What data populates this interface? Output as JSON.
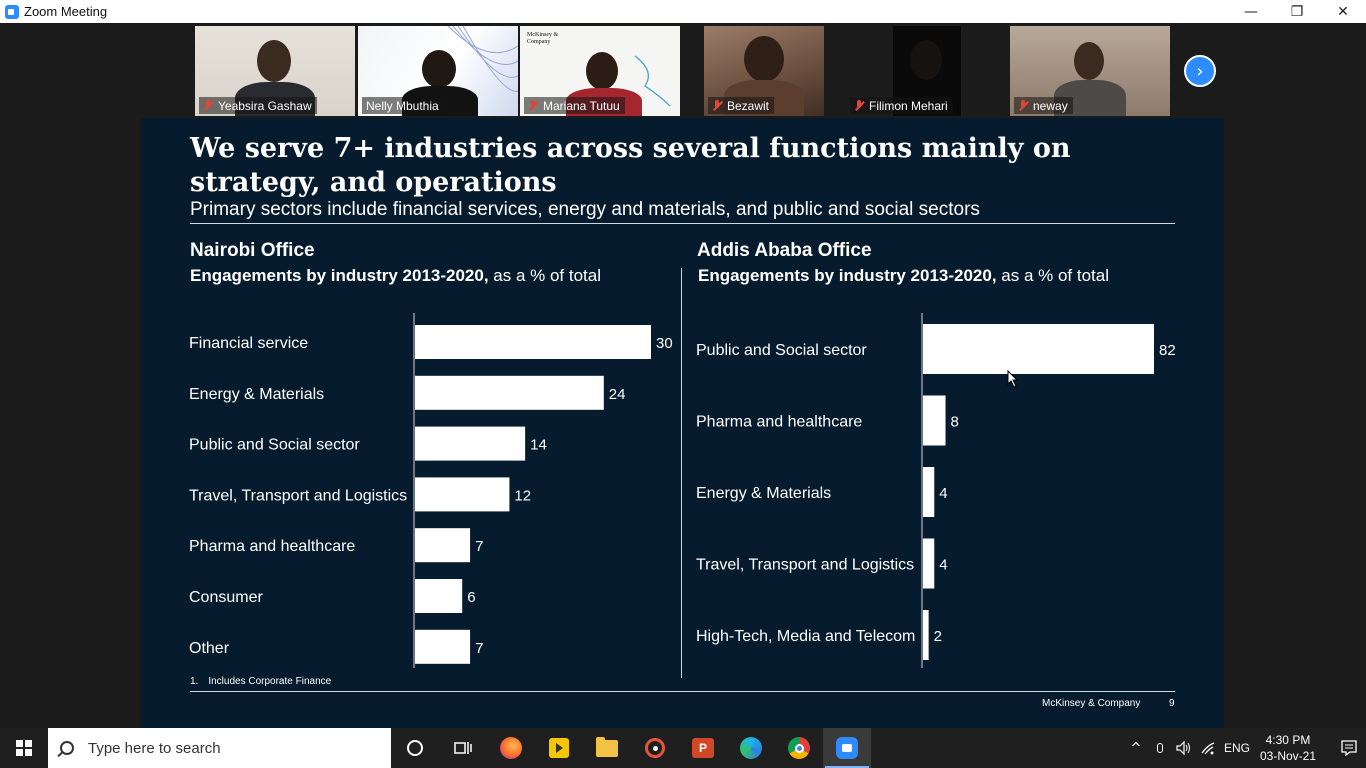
{
  "window": {
    "title": "Zoom Meeting",
    "minimize": "—",
    "restore": "❐",
    "close": "✕"
  },
  "participants": [
    {
      "name": "Yeabsira Gashaw",
      "muted": true,
      "active": false
    },
    {
      "name": "Nelly Mbuthia",
      "muted": false,
      "active": true
    },
    {
      "name": "Mariana Tutuu",
      "muted": true,
      "active": false,
      "logo": "McKinsey & Company"
    },
    {
      "name": "Bezawit",
      "muted": true,
      "active": false
    },
    {
      "name": "Filimon Mehari",
      "muted": true,
      "active": false
    },
    {
      "name": "neway",
      "muted": true,
      "active": false
    }
  ],
  "next_page_glyph": "›",
  "slide": {
    "title": "We serve 7+ industries across several functions mainly on strategy, and operations",
    "subtitle": "Primary sectors include financial services, energy and materials, and public and social sectors",
    "left_office": "Nairobi Office",
    "right_office": "Addis Ababa Office",
    "eng_bold": "Engagements by industry 2013-2020,",
    "eng_rest": " as a % of total",
    "footnote_num": "1.",
    "footnote_text": "Includes Corporate Finance",
    "brand": "McKinsey & Company",
    "page": "9"
  },
  "chart_data": [
    {
      "type": "bar",
      "orientation": "horizontal",
      "title": "Nairobi Office",
      "categories": [
        "Financial service",
        "Energy & Materials",
        "Public and Social sector",
        "Travel, Transport and Logistics",
        "Pharma and healthcare",
        "Consumer",
        "Other"
      ],
      "values": [
        30,
        24,
        14,
        12,
        7,
        6,
        7
      ],
      "xlim": [
        0,
        30
      ],
      "grid": false,
      "bar_color": "#ffffff"
    },
    {
      "type": "bar",
      "orientation": "horizontal",
      "title": "Addis Ababa Office",
      "categories": [
        "Public and Social sector",
        "Pharma and healthcare",
        "Energy & Materials",
        "Travel, Transport and Logistics",
        "High-Tech, Media and Telecom"
      ],
      "values": [
        82,
        8,
        4,
        4,
        2
      ],
      "xlim": [
        0,
        82
      ],
      "grid": false,
      "bar_color": "#ffffff"
    }
  ],
  "taskbar": {
    "search_placeholder": "Type here to search",
    "apps": [
      "cortana-icon",
      "task-view-icon",
      "firefox-icon",
      "media-player-icon",
      "file-explorer-icon",
      "groove-icon",
      "powerpoint-icon",
      "edge-icon",
      "chrome-icon",
      "zoom-icon"
    ],
    "tray_expand": "^",
    "language": "ENG",
    "time": "4:30 PM",
    "date": "03-Nov-21"
  },
  "colors": {
    "slide_bg": "#061b2d",
    "accent": "#2d8cff",
    "active_speaker": "#c9e265",
    "muted": "#e0453a"
  }
}
